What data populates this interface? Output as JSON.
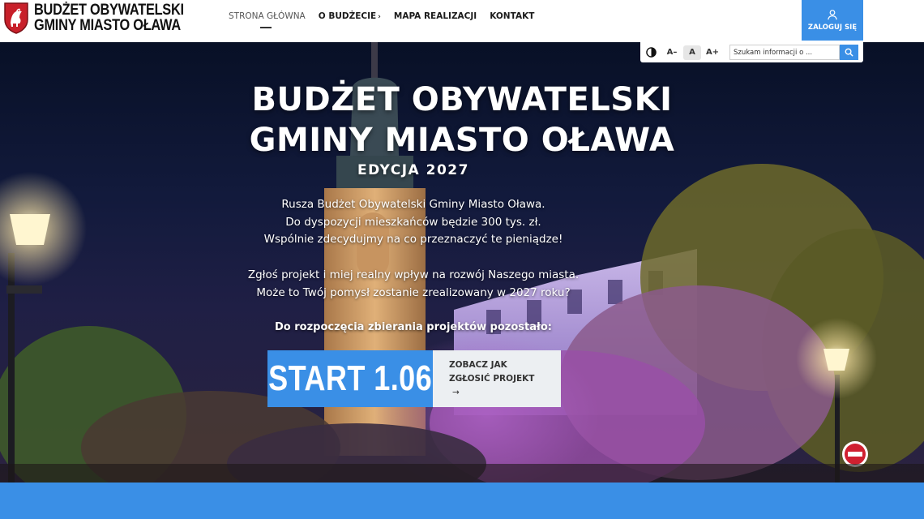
{
  "header": {
    "logo_line1": "BUDŻET OBYWATELSKI",
    "logo_line2": "GMINY MIASTO OŁAWA",
    "nav": [
      {
        "label": "STRONA GŁÓWNA",
        "active": true
      },
      {
        "label": "O BUDŻECIE",
        "has_submenu": true
      },
      {
        "label": "MAPA REALIZACJI"
      },
      {
        "label": "KONTAKT"
      }
    ],
    "login_label": "ZALOGUJ SIĘ"
  },
  "toolbar": {
    "contrast_icon": "contrast-icon",
    "font_decrease": "A–",
    "font_normal": "A",
    "font_increase": "A+",
    "search_placeholder": "Szukam informacji o ...",
    "search_icon": "search-icon"
  },
  "hero": {
    "title_line1": "BUDŻET OBYWATELSKI",
    "title_line2": "GMINY MIASTO OŁAWA",
    "edition": "EDYCJA 2027",
    "paragraph1": [
      "Rusza Budżet Obywatelski Gminy Miasto Oława.",
      "Do dyspozycji mieszkańców będzie 300 tys. zł.",
      "Wspólnie zdecydujmy na co przeznaczyć te pieniądze!"
    ],
    "paragraph2": [
      "Zgłoś projekt i miej realny wpływ na rozwój Naszego miasta.",
      "Może to Twój pomysł zostanie zrealizowany w 2027 roku?"
    ],
    "countdown_label": "Do rozpoczęcia zbierania projektów pozostało:",
    "start_label": "START 1.06",
    "howto_line1": "ZOBACZ JAK",
    "howto_line2": "ZGŁOSIĆ PROJEKT",
    "howto_arrow": "→"
  },
  "colors": {
    "accent": "#3a8fe6",
    "header_bg": "#ffffff",
    "howto_bg": "#eceff2"
  }
}
